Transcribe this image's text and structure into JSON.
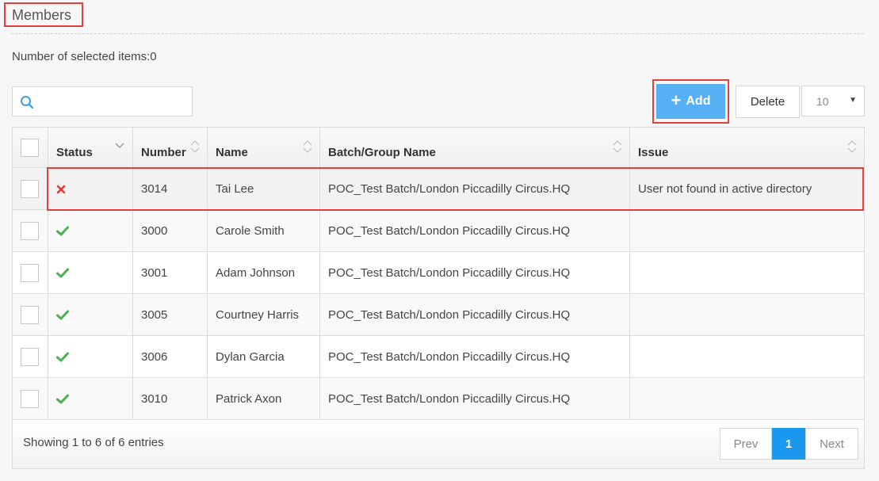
{
  "section": {
    "title": "Members"
  },
  "selection": {
    "count_label": "Number of selected items:0"
  },
  "search": {
    "placeholder": "",
    "value": ""
  },
  "toolbar": {
    "add_label": "Add",
    "delete_label": "Delete",
    "page_size": "10"
  },
  "table": {
    "columns": {
      "status": "Status",
      "number": "Number",
      "name": "Name",
      "batch": "Batch/Group Name",
      "issue": "Issue"
    },
    "rows": [
      {
        "status": "error",
        "number": "3014",
        "name": "Tai Lee",
        "batch": "POC_Test Batch/London Piccadilly Circus.HQ",
        "issue": "User not found in active directory"
      },
      {
        "status": "ok",
        "number": "3000",
        "name": "Carole Smith",
        "batch": "POC_Test Batch/London Piccadilly Circus.HQ",
        "issue": ""
      },
      {
        "status": "ok",
        "number": "3001",
        "name": "Adam Johnson",
        "batch": "POC_Test Batch/London Piccadilly Circus.HQ",
        "issue": ""
      },
      {
        "status": "ok",
        "number": "3005",
        "name": "Courtney Harris",
        "batch": "POC_Test Batch/London Piccadilly Circus.HQ",
        "issue": ""
      },
      {
        "status": "ok",
        "number": "3006",
        "name": "Dylan Garcia",
        "batch": "POC_Test Batch/London Piccadilly Circus.HQ",
        "issue": ""
      },
      {
        "status": "ok",
        "number": "3010",
        "name": "Patrick Axon",
        "batch": "POC_Test Batch/London Piccadilly Circus.HQ",
        "issue": ""
      }
    ]
  },
  "footer": {
    "showing": "Showing 1 to 6 of 6 entries",
    "prev": "Prev",
    "current_page": "1",
    "next": "Next"
  },
  "colors": {
    "accent": "#56b0f3",
    "pager_active": "#1a98f0",
    "ok": "#4caf50",
    "error": "#e53935",
    "highlight": "#e2403a"
  },
  "icons": {
    "search": "search-icon",
    "add": "plus-icon",
    "ok": "check-icon",
    "error": "cross-icon",
    "sort": "sort-icon",
    "filter": "chevron-down-icon"
  }
}
